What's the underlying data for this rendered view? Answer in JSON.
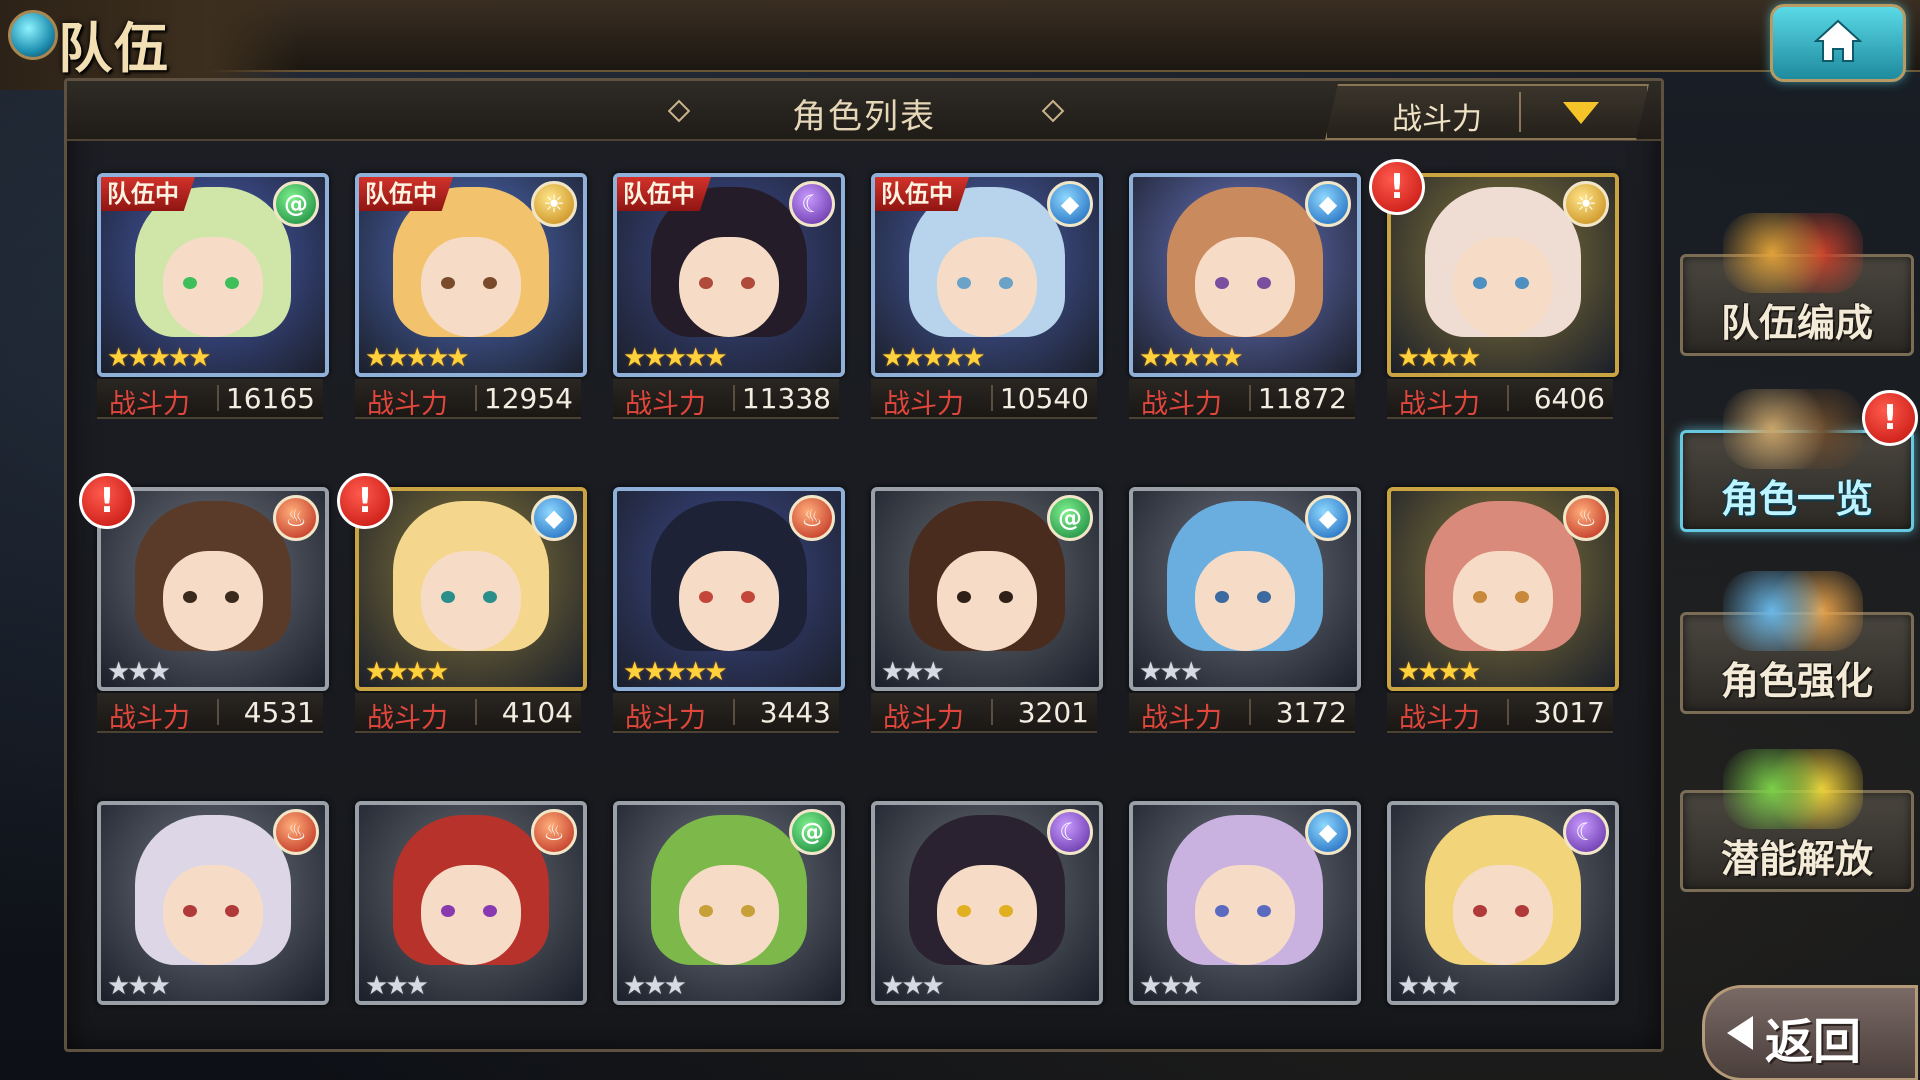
{
  "header": {
    "page_title": "队伍",
    "list_title": "角色列表",
    "sort_label": "战斗力"
  },
  "power_label": "战斗力",
  "team_tag_label": "队伍中",
  "characters": [
    {
      "id": "c1",
      "element": "wind",
      "element_glyph": "@",
      "rarity": 5,
      "in_team": true,
      "alert": false,
      "power": "16165",
      "frame": "blue",
      "hair": "#cfe6a8",
      "eye": "#3fbf5a",
      "bg": "#4a5fb8"
    },
    {
      "id": "c2",
      "element": "light",
      "element_glyph": "☀",
      "rarity": 5,
      "in_team": true,
      "alert": false,
      "power": "12954",
      "frame": "blue",
      "hair": "#f2c36c",
      "eye": "#7a4b2a",
      "bg": "#5270c4"
    },
    {
      "id": "c3",
      "element": "dark",
      "element_glyph": "☾",
      "rarity": 5,
      "in_team": true,
      "alert": false,
      "power": "11338",
      "frame": "blue",
      "hair": "#241c28",
      "eye": "#b04a3a",
      "bg": "#3e4b8e"
    },
    {
      "id": "c4",
      "element": "water",
      "element_glyph": "◆",
      "rarity": 5,
      "in_team": true,
      "alert": false,
      "power": "10540",
      "frame": "blue",
      "hair": "#b7d4ec",
      "eye": "#6ba3c8",
      "bg": "#4c61b0"
    },
    {
      "id": "c5",
      "element": "water",
      "element_glyph": "◆",
      "rarity": 5,
      "in_team": false,
      "alert": false,
      "power": "11872",
      "frame": "blue",
      "hair": "#c98a5e",
      "eye": "#7a4fa0",
      "bg": "#6b79c8"
    },
    {
      "id": "c6",
      "element": "light",
      "element_glyph": "☀",
      "rarity": 4,
      "in_team": false,
      "alert": true,
      "power": "6406",
      "frame": "gold",
      "hair": "#efdcd2",
      "eye": "#4d8fc0",
      "bg": "#8a7a3a"
    },
    {
      "id": "c7",
      "element": "fire",
      "element_glyph": "♨",
      "rarity": 3,
      "in_team": false,
      "alert": true,
      "power": "4531",
      "frame": "silver",
      "hair": "#5a3a28",
      "eye": "#3a2a1e",
      "bg": "#707680"
    },
    {
      "id": "c8",
      "element": "water",
      "element_glyph": "◆",
      "rarity": 4,
      "in_team": false,
      "alert": true,
      "power": "4104",
      "frame": "gold",
      "hair": "#f4d68c",
      "eye": "#2a8f8a",
      "bg": "#8a7a3a"
    },
    {
      "id": "c9",
      "element": "fire",
      "element_glyph": "♨",
      "rarity": 5,
      "in_team": false,
      "alert": false,
      "power": "3443",
      "frame": "blue",
      "hair": "#1e2236",
      "eye": "#c4463a",
      "bg": "#3e4b8e"
    },
    {
      "id": "c10",
      "element": "wind",
      "element_glyph": "@",
      "rarity": 3,
      "in_team": false,
      "alert": false,
      "power": "3201",
      "frame": "silver",
      "hair": "#4a2c1e",
      "eye": "#2e2018",
      "bg": "#6a6e74"
    },
    {
      "id": "c11",
      "element": "water",
      "element_glyph": "◆",
      "rarity": 3,
      "in_team": false,
      "alert": false,
      "power": "3172",
      "frame": "silver",
      "hair": "#6aaee0",
      "eye": "#3a6aa0",
      "bg": "#707680"
    },
    {
      "id": "c12",
      "element": "fire",
      "element_glyph": "♨",
      "rarity": 4,
      "in_team": false,
      "alert": false,
      "power": "3017",
      "frame": "gold",
      "hair": "#d98a7a",
      "eye": "#c88a3a",
      "bg": "#8a7a3a"
    },
    {
      "id": "c13",
      "element": "fire",
      "element_glyph": "♨",
      "rarity": 3,
      "in_team": false,
      "alert": false,
      "power": "",
      "frame": "silver",
      "hair": "#dcd6e6",
      "eye": "#b03a3a",
      "bg": "#707680"
    },
    {
      "id": "c14",
      "element": "fire",
      "element_glyph": "♨",
      "rarity": 3,
      "in_team": false,
      "alert": false,
      "power": "",
      "frame": "silver",
      "hair": "#b8322c",
      "eye": "#8a3ab0",
      "bg": "#6a6e74"
    },
    {
      "id": "c15",
      "element": "wind",
      "element_glyph": "@",
      "rarity": 3,
      "in_team": false,
      "alert": false,
      "power": "",
      "frame": "silver",
      "hair": "#7cb84a",
      "eye": "#c8a03a",
      "bg": "#707680"
    },
    {
      "id": "c16",
      "element": "dark",
      "element_glyph": "☾",
      "rarity": 3,
      "in_team": false,
      "alert": false,
      "power": "",
      "frame": "silver",
      "hair": "#2a2230",
      "eye": "#e0b020",
      "bg": "#6a6e74"
    },
    {
      "id": "c17",
      "element": "water",
      "element_glyph": "◆",
      "rarity": 3,
      "in_team": false,
      "alert": false,
      "power": "",
      "frame": "silver",
      "hair": "#c9b2e0",
      "eye": "#5a6ac0",
      "bg": "#707680"
    },
    {
      "id": "c18",
      "element": "dark",
      "element_glyph": "☾",
      "rarity": 3,
      "in_team": false,
      "alert": false,
      "power": "",
      "frame": "silver",
      "hair": "#f2d47a",
      "eye": "#b03a3a",
      "bg": "#6a6e74"
    }
  ],
  "side_menu": [
    {
      "id": "team-edit",
      "label": "队伍编成",
      "active": false,
      "alert": false
    },
    {
      "id": "character-list",
      "label": "角色一览",
      "active": true,
      "alert": true
    },
    {
      "id": "character-enhance",
      "label": "角色强化",
      "active": false,
      "alert": false
    },
    {
      "id": "potential-unlock",
      "label": "潜能解放",
      "active": false,
      "alert": false
    }
  ],
  "back_label": "返回",
  "colors": {
    "accent_gold": "#f4c429",
    "team_tag_red": "#d2322b",
    "power_label_red": "#e0463c",
    "active_cyan": "#66c9e0"
  }
}
